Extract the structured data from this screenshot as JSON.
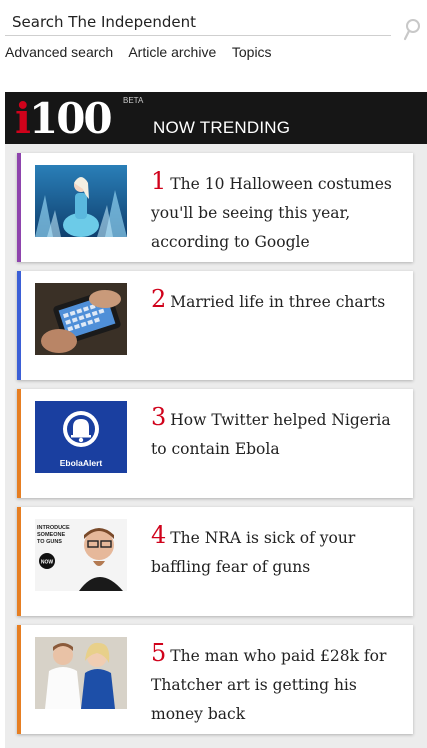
{
  "search": {
    "placeholder": "Search The Independent",
    "icon": "search-icon"
  },
  "links": [
    "Advanced search",
    "Article archive",
    "Topics"
  ],
  "trending": {
    "logo_text": "i100",
    "logo_accent": "i",
    "logo_rest": "100",
    "beta_label": "BETA",
    "title": "NOW TRENDING",
    "items": [
      {
        "number": "1",
        "title": "The 10 Halloween costumes you'll be seeing this year, according to Google",
        "accent": "#8e44ad"
      },
      {
        "number": "2",
        "title": "Married life in three charts",
        "accent": "#3b5fd6"
      },
      {
        "number": "3",
        "title": "How Twitter helped Nigeria to contain Ebola",
        "accent": "#e67e22",
        "thumb_caption": "EbolaAlert"
      },
      {
        "number": "4",
        "title": "The NRA is sick of your baffling fear of guns",
        "accent": "#e67e22",
        "thumb_caption": "INTRODUCE SOMEONE TO GUNS NOW"
      },
      {
        "number": "5",
        "title": "The man who paid £28k for Thatcher art is getting his money back",
        "accent": "#e67e22"
      }
    ]
  },
  "colors": {
    "header_bg": "#161616",
    "number_red": "#d0021b",
    "panel_bg": "#ececec"
  }
}
